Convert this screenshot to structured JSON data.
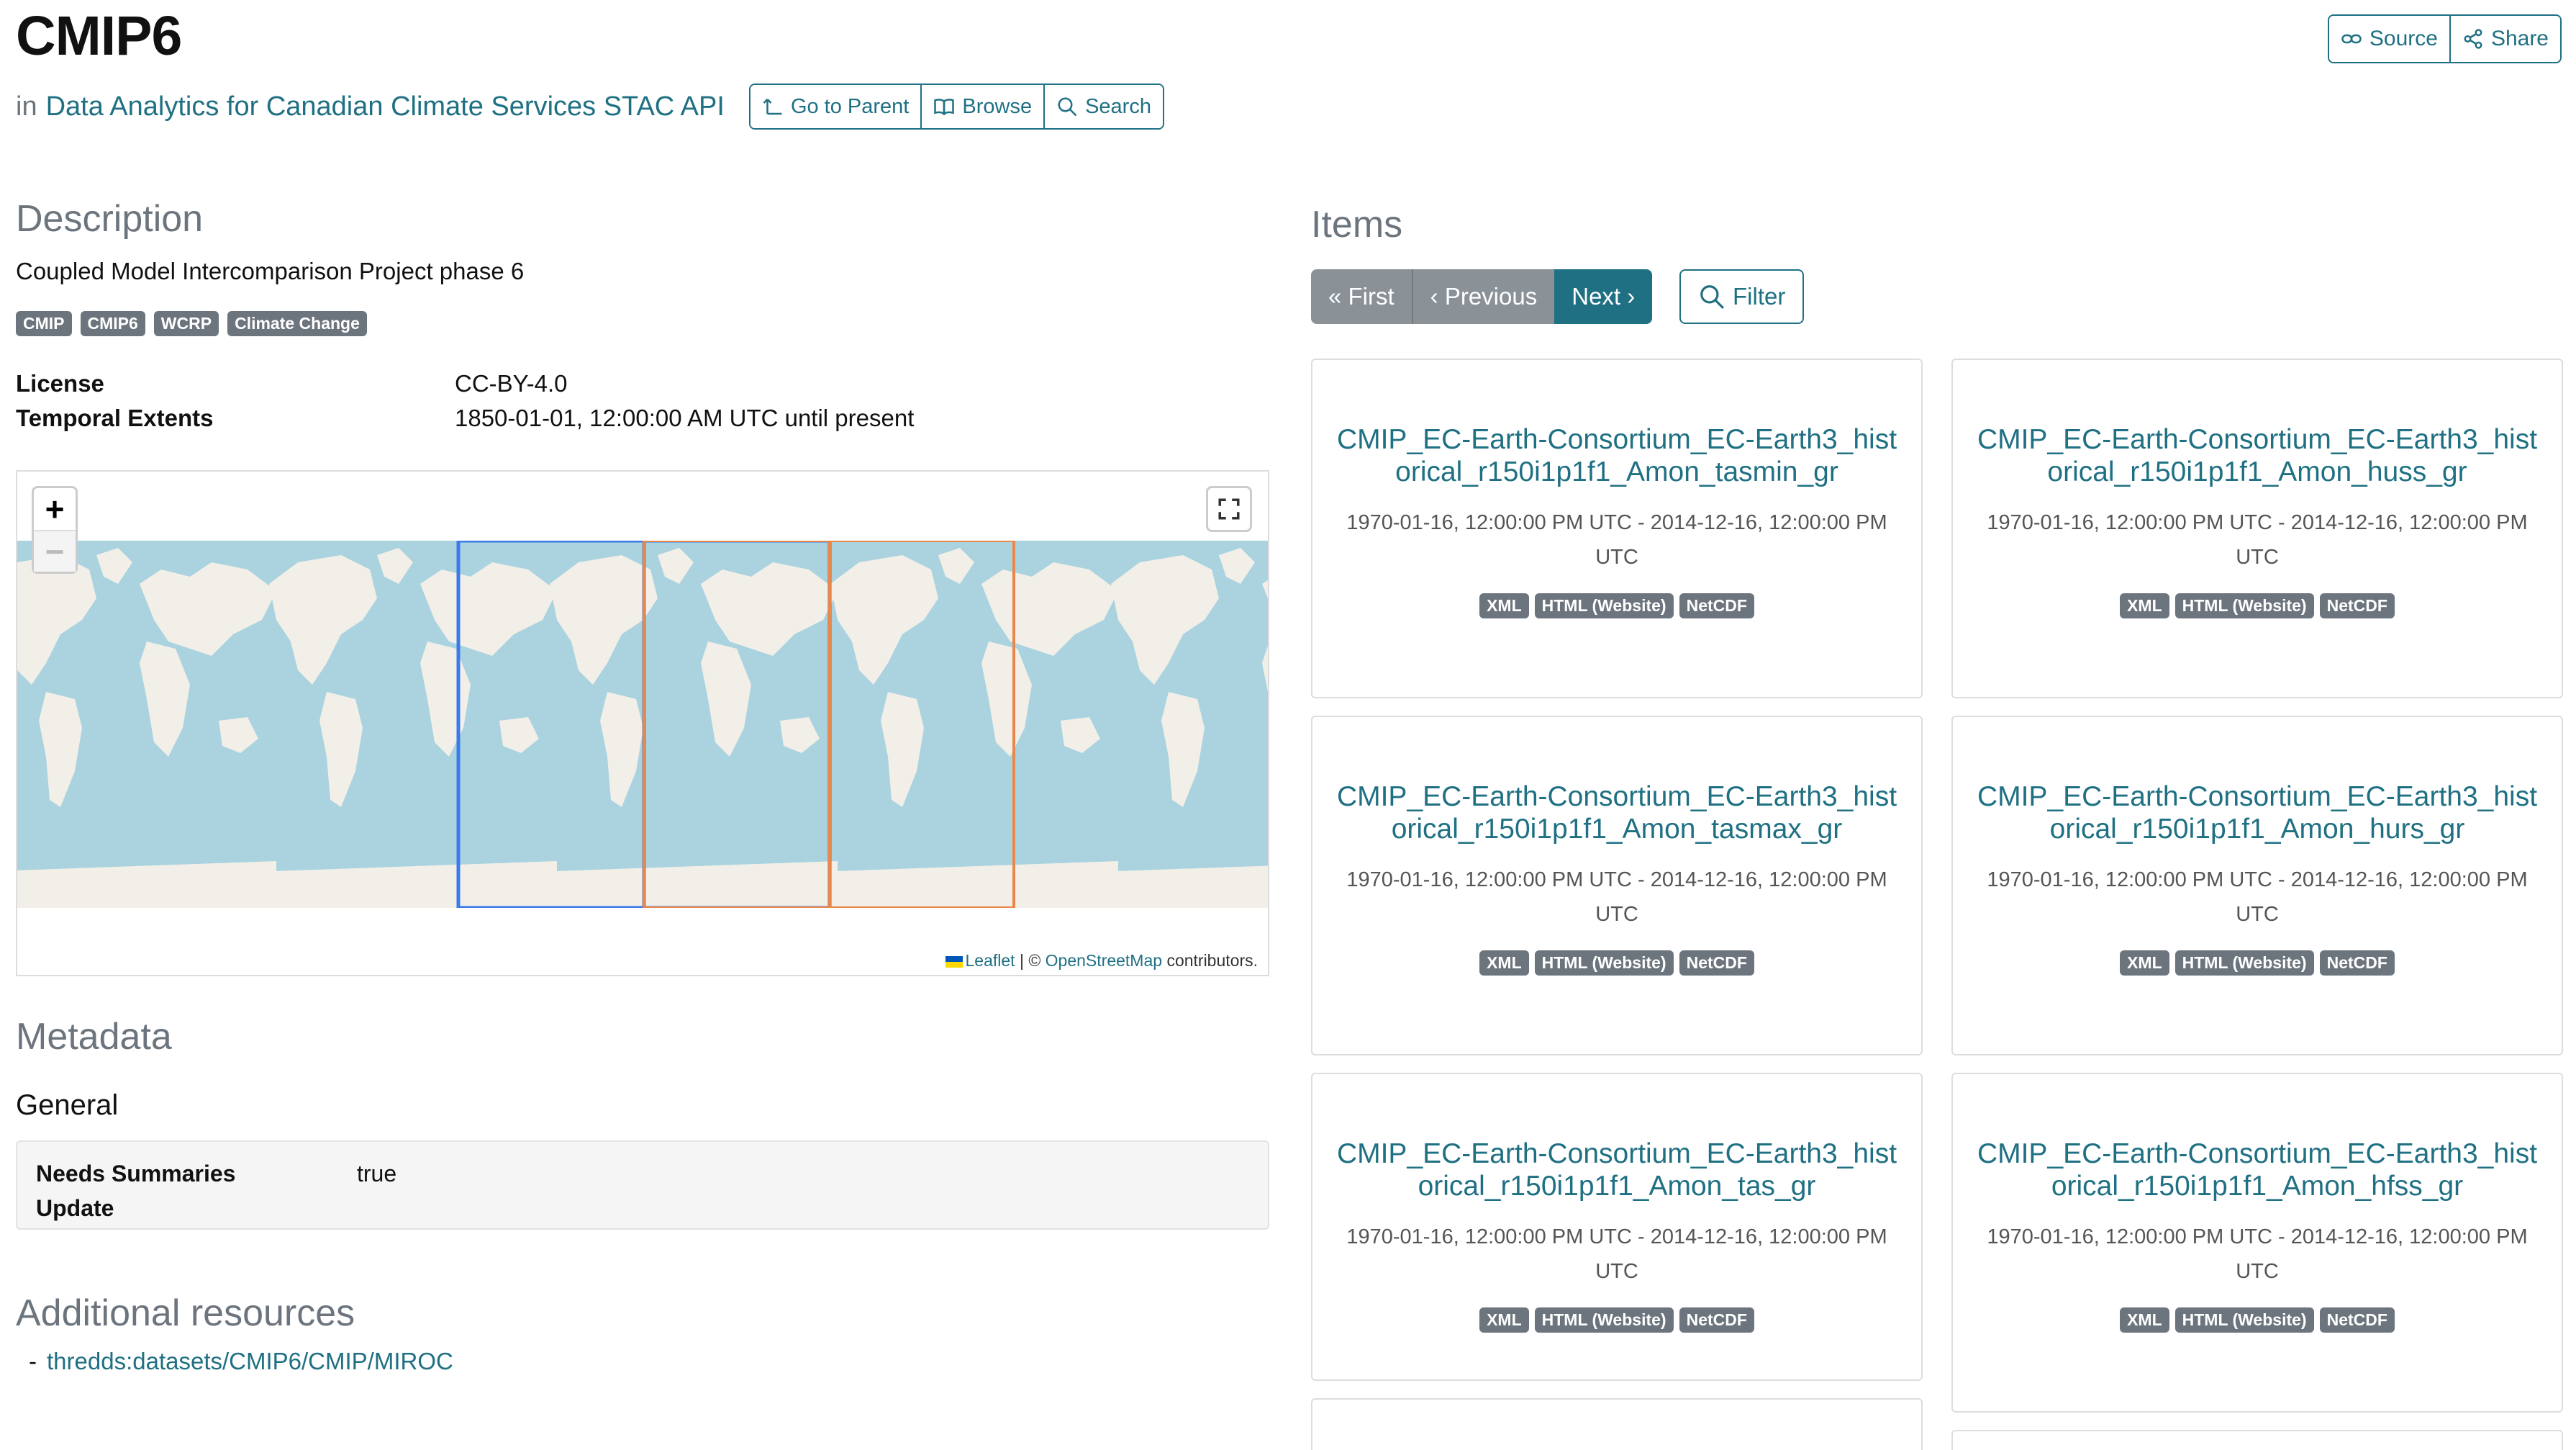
{
  "header": {
    "title": "CMIP6",
    "in_label": "in",
    "parent_link": "Data Analytics for Canadian Climate Services STAC API",
    "nav_buttons": [
      "Go to Parent",
      "Browse",
      "Search"
    ],
    "source_label": "Source",
    "share_label": "Share"
  },
  "description": {
    "heading": "Description",
    "text": "Coupled Model Intercomparison Project phase 6",
    "keywords": [
      "CMIP",
      "CMIP6",
      "WCRP",
      "Climate Change"
    ]
  },
  "properties": {
    "license_label": "License",
    "license_value": "CC-BY-4.0",
    "temporal_label": "Temporal Extents",
    "temporal_value": "1850-01-01, 12:00:00 AM UTC until present"
  },
  "map": {
    "zoom_in": "+",
    "zoom_out": "−",
    "attribution_leaflet": "Leaflet",
    "attribution_sep": "| ©",
    "attribution_osm": "OpenStreetMap",
    "attribution_tail": "contributors.",
    "colors": {
      "water": "#aad3df",
      "land": "#f2efe9",
      "bbox_blue": "#3b7ae8",
      "bbox_orange": "#e8884a"
    }
  },
  "metadata": {
    "heading": "Metadata",
    "general_heading": "General",
    "needs_summaries_label": "Needs Summaries Update",
    "needs_summaries_value": "true"
  },
  "resources": {
    "heading": "Additional resources",
    "dash": "-",
    "items": [
      "thredds:datasets/CMIP6/CMIP/MIROC"
    ]
  },
  "items": {
    "heading": "Items",
    "pager": {
      "first": "« First",
      "previous": "‹ Previous",
      "next": "Next ›"
    },
    "filter_label": "Filter",
    "cards": [
      {
        "title": "CMIP_EC-Earth-Consortium_EC-Earth3_historical_r150i1p1f1_Amon_tasmin_gr",
        "date": "1970-01-16, 12:00:00 PM UTC - 2014-12-16, 12:00:00 PM UTC",
        "assets": [
          "XML",
          "HTML (Website)",
          "NetCDF"
        ]
      },
      {
        "title": "CMIP_EC-Earth-Consortium_EC-Earth3_historical_r150i1p1f1_Amon_huss_gr",
        "date": "1970-01-16, 12:00:00 PM UTC - 2014-12-16, 12:00:00 PM UTC",
        "assets": [
          "XML",
          "HTML (Website)",
          "NetCDF"
        ]
      },
      {
        "title": "CMIP_EC-Earth-Consortium_EC-Earth3_historical_r150i1p1f1_Amon_tasmax_gr",
        "date": "1970-01-16, 12:00:00 PM UTC - 2014-12-16, 12:00:00 PM UTC",
        "assets": [
          "XML",
          "HTML (Website)",
          "NetCDF"
        ]
      },
      {
        "title": "CMIP_EC-Earth-Consortium_EC-Earth3_historical_r150i1p1f1_Amon_hurs_gr",
        "date": "1970-01-16, 12:00:00 PM UTC - 2014-12-16, 12:00:00 PM UTC",
        "assets": [
          "XML",
          "HTML (Website)",
          "NetCDF"
        ]
      },
      {
        "title": "CMIP_EC-Earth-Consortium_EC-Earth3_historical_r150i1p1f1_Amon_tas_gr",
        "date": "1970-01-16, 12:00:00 PM UTC - 2014-12-16, 12:00:00 PM UTC",
        "assets": [
          "XML",
          "HTML (Website)",
          "NetCDF"
        ]
      },
      {
        "title": "CMIP_EC-Earth-Consortium_EC-Earth3_historical_r150i1p1f1_Amon_hfss_gr",
        "date": "1970-01-16, 12:00:00 PM UTC - 2014-12-16, 12:00:00 PM UTC",
        "assets": [
          "XML",
          "HTML (Website)",
          "NetCDF"
        ]
      }
    ]
  }
}
